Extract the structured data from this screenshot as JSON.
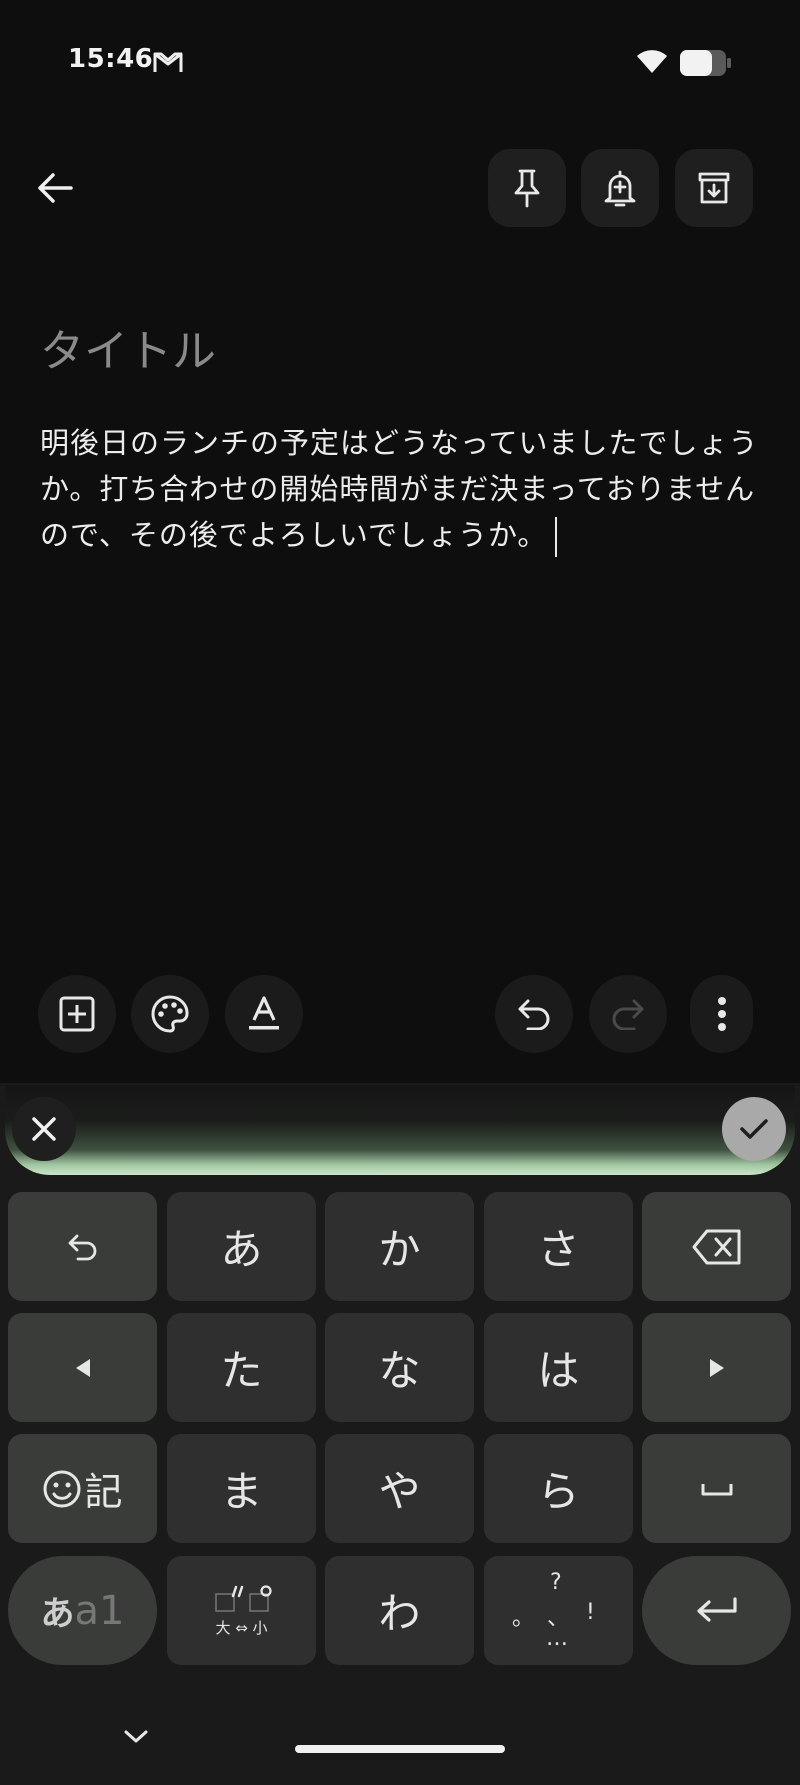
{
  "status_bar": {
    "time": "15:46"
  },
  "note": {
    "title_placeholder": "タイトル",
    "body_text": "明後日のランチの予定はどうなっていましたでしょうか。打ち合わせの開始時間がまだ決まっておりませんので、その後でよろしいでしょうか。"
  },
  "keyboard": {
    "keys": {
      "a": "あ",
      "ka": "か",
      "sa": "さ",
      "ta": "た",
      "na": "な",
      "ha": "は",
      "ma": "ま",
      "ya": "や",
      "ra": "ら",
      "wa": "わ",
      "symbols_label": "記",
      "mode_hira": "あ",
      "mode_alpha": "a1",
      "size_toggle_label": "大 ⇔ 小",
      "punct_question": "?",
      "punct_period": "。",
      "punct_comma": "、",
      "punct_excl": "!",
      "punct_ellipsis": "…"
    }
  },
  "colors": {
    "background": "#0e0e0e",
    "button_bg": "#1f1f1f",
    "key_bg": "#2e2f2e",
    "function_key_bg": "#3a3c3a",
    "accent_green": "#c9e6c8"
  },
  "icons": [
    "gmail-icon",
    "wifi-icon",
    "battery-icon",
    "back-arrow-icon",
    "pin-icon",
    "reminder-bell-icon",
    "archive-icon",
    "add-box-icon",
    "palette-icon",
    "text-format-icon",
    "undo-icon",
    "redo-icon",
    "more-vert-icon",
    "close-icon",
    "check-icon",
    "backspace-icon",
    "arrow-left-icon",
    "arrow-right-icon",
    "emoji-icon",
    "space-icon",
    "enter-icon",
    "chevron-down-icon"
  ]
}
